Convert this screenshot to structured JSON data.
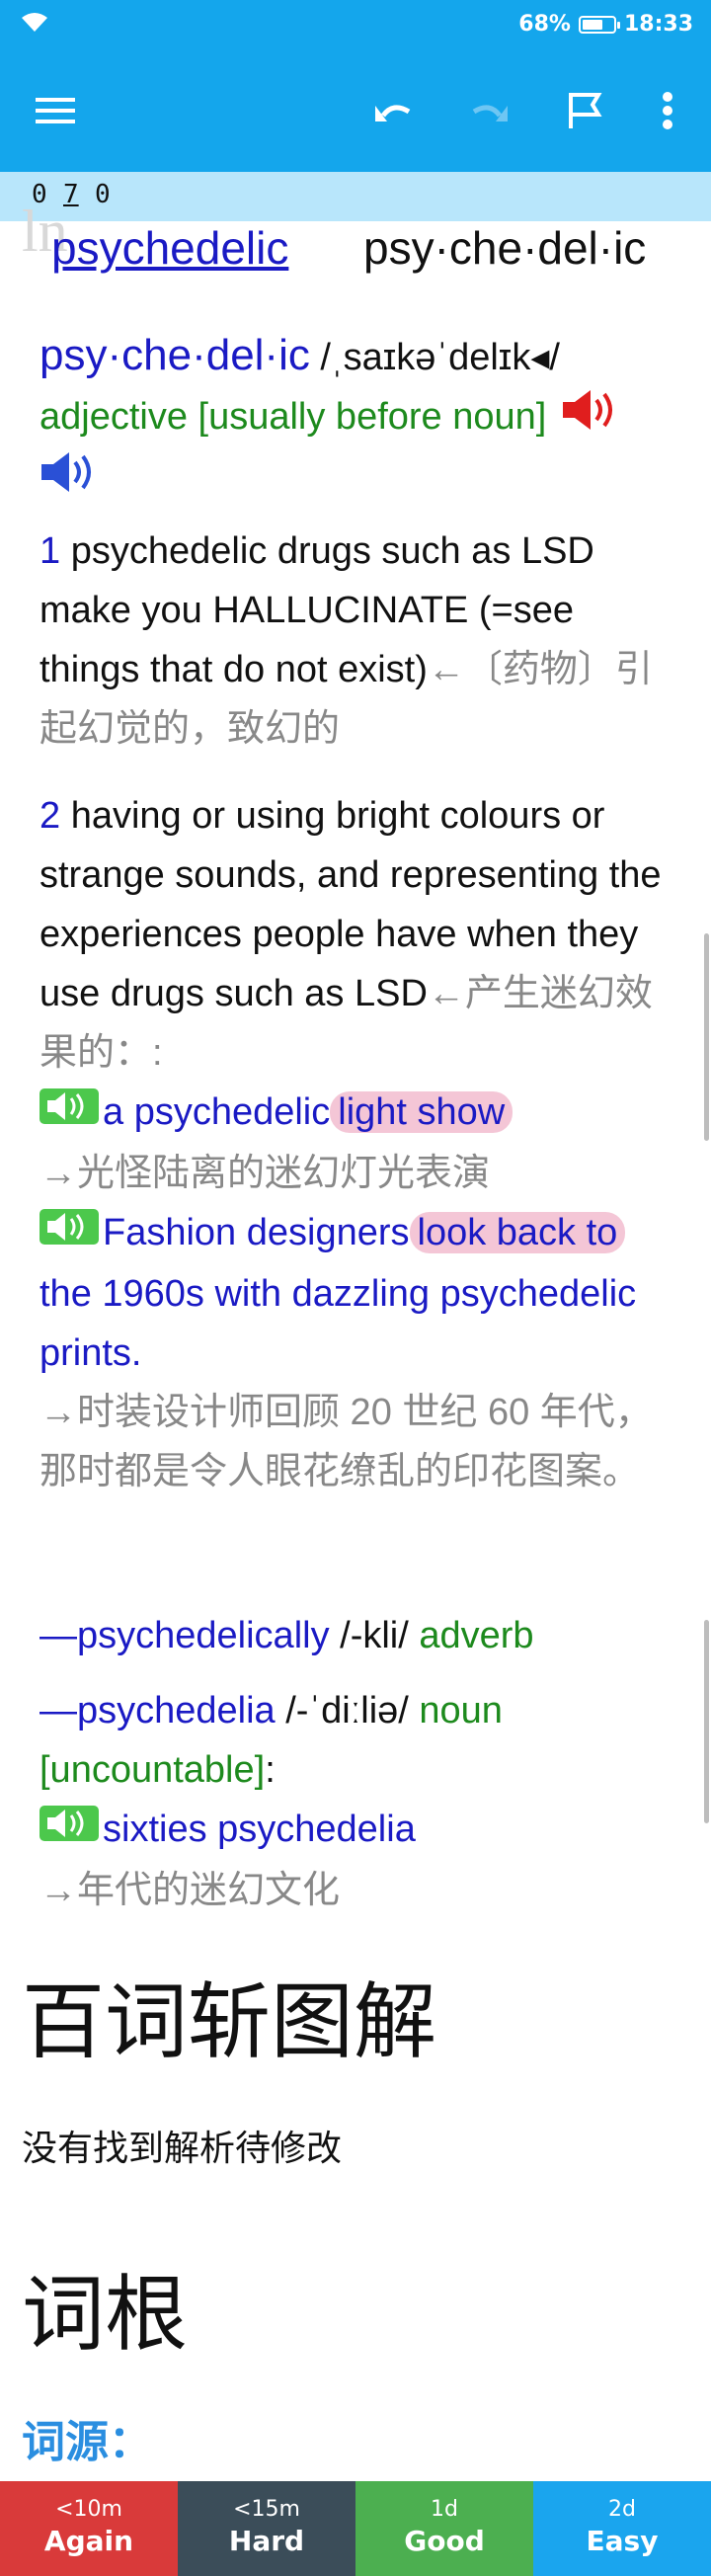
{
  "status": {
    "battery": "68%",
    "battery_level": 0.68,
    "time": "18:33"
  },
  "toolbar": {
    "menu_icon": "hamburger-menu-icon",
    "undo_icon": "undo-icon",
    "redo_icon": "redo-icon",
    "flag_icon": "flag-icon",
    "more_icon": "more-vert-icon"
  },
  "counter": {
    "d1": "0",
    "d2": "7",
    "d3": "0"
  },
  "headword": {
    "ghost": "ln",
    "link": "psychedelic",
    "syllables": "psy·che·del·ic"
  },
  "entry": {
    "title": "psy·che·del·ic",
    "pron": " /ˌsaɪkəˈdelɪk◂/",
    "pos": "adjective [usually before noun]",
    "sense1": {
      "num": "1",
      "text_a": "psychedelic drugs such as ",
      "sc1": "LSD",
      "text_b": " make you ",
      "sc2": "HALLUCINATE",
      "text_c": " (=see things that do not exist)",
      "cn": "←〔药物〕引起幻觉的，致幻的"
    },
    "sense2": {
      "num": "2",
      "text_a": "having or using bright colours or strange sounds, and representing the experiences people have when they use drugs such as ",
      "sc1": "LSD",
      "cn": "←产生迷幻效果的：:",
      "ex1": {
        "pre": "a psychedelic",
        "hl": "light show",
        "cn": "→光怪陆离的迷幻灯光表演"
      },
      "ex2": {
        "pre": "Fashion designers",
        "hl": "look back to",
        "post": "the 1960s with dazzling psychedelic prints.",
        "cn": "→时装设计师回顾 20 世纪 60 年代，那时都是令人眼花缭乱的印花图案。"
      }
    },
    "deriv1": {
      "word": "—psychedelically",
      "pron": " /-kli/ ",
      "pos": "adverb"
    },
    "deriv2": {
      "word": "—psychedelia",
      "pron": " /-ˈdiːliə/ ",
      "pos": "noun",
      "tag": "[uncountable]",
      "colon": ":",
      "ex": "sixties psychedelia",
      "cn": "→年代的迷幻文化"
    }
  },
  "section1": {
    "title": "百词斩图解",
    "text": "没有找到解析待修改"
  },
  "section2": {
    "title": "词根",
    "etym_label": "词源："
  },
  "answers": [
    {
      "time": "<10m",
      "label": "Again",
      "color": "#d93a3a"
    },
    {
      "time": "<15m",
      "label": "Hard",
      "color": "#3b4d59"
    },
    {
      "time": "1d",
      "label": "Good",
      "color": "#4caf50"
    },
    {
      "time": "2d",
      "label": "Easy",
      "color": "#1aa5ee"
    }
  ]
}
